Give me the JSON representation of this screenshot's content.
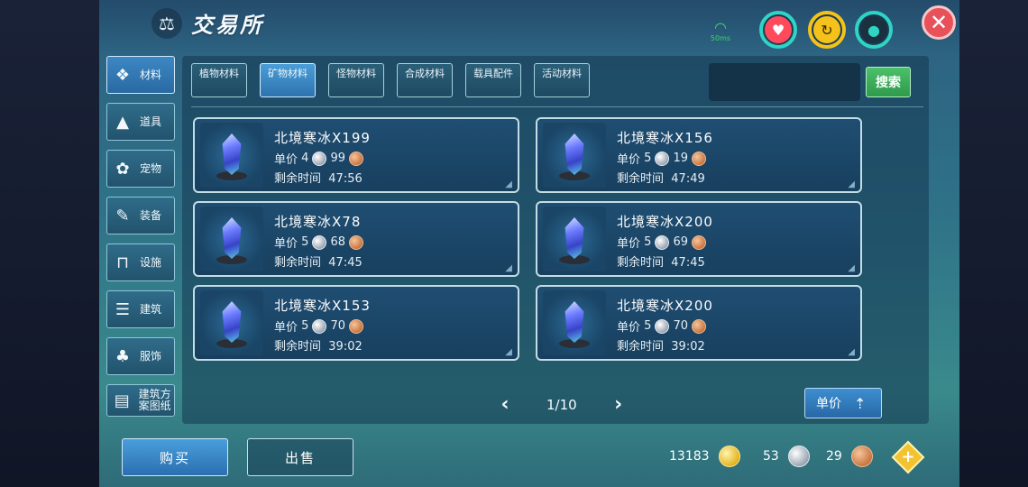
{
  "header": {
    "title": "交易所",
    "title_icon": "scale-icon"
  },
  "status": {
    "ping": "50ms",
    "icons": [
      "wifi-icon",
      "heart-icon",
      "arrow-icon",
      "drop-icon"
    ]
  },
  "sidebar": {
    "items": [
      {
        "label": "材料",
        "icon": "materials-icon",
        "active": true
      },
      {
        "label": "道具",
        "icon": "item-icon",
        "active": false
      },
      {
        "label": "宠物",
        "icon": "paw-icon",
        "active": false
      },
      {
        "label": "装备",
        "icon": "equipment-icon",
        "active": false
      },
      {
        "label": "设施",
        "icon": "facility-icon",
        "active": false
      },
      {
        "label": "建筑",
        "icon": "building-icon",
        "active": false
      },
      {
        "label": "服饰",
        "icon": "clothing-icon",
        "active": false
      },
      {
        "label": "建筑方案图纸",
        "icon": "blueprint-icon",
        "active": false
      }
    ]
  },
  "tabs": [
    {
      "label": "植物材料",
      "active": false
    },
    {
      "label": "矿物材料",
      "active": true
    },
    {
      "label": "怪物材料",
      "active": false
    },
    {
      "label": "合成材料",
      "active": false
    },
    {
      "label": "载具配件",
      "active": false
    },
    {
      "label": "活动材料",
      "active": false
    }
  ],
  "search": {
    "placeholder": "",
    "button_label": "搜索"
  },
  "listings": [
    {
      "name": "北境寒冰X199",
      "price_label": "单价",
      "silver": "4",
      "copper": "99",
      "time_label": "剩余时间",
      "time": "47:56"
    },
    {
      "name": "北境寒冰X156",
      "price_label": "单价",
      "silver": "5",
      "copper": "19",
      "time_label": "剩余时间",
      "time": "47:49"
    },
    {
      "name": "北境寒冰X78",
      "price_label": "单价",
      "silver": "5",
      "copper": "68",
      "time_label": "剩余时间",
      "time": "47:45"
    },
    {
      "name": "北境寒冰X200",
      "price_label": "单价",
      "silver": "5",
      "copper": "69",
      "time_label": "剩余时间",
      "time": "47:45"
    },
    {
      "name": "北境寒冰X153",
      "price_label": "单价",
      "silver": "5",
      "copper": "70",
      "time_label": "剩余时间",
      "time": "39:02"
    },
    {
      "name": "北境寒冰X200",
      "price_label": "单价",
      "silver": "5",
      "copper": "70",
      "time_label": "剩余时间",
      "time": "39:02"
    }
  ],
  "pager": {
    "text": "1/10"
  },
  "sort": {
    "label": "单价"
  },
  "footer": {
    "buy_label": "购买",
    "sell_label": "出售"
  },
  "currency": {
    "gold": "13183",
    "silver": "53",
    "copper": "29"
  },
  "colors": {
    "accent": "#3d8ed0",
    "search": "#2f9a4c",
    "close": "#e8505a"
  }
}
